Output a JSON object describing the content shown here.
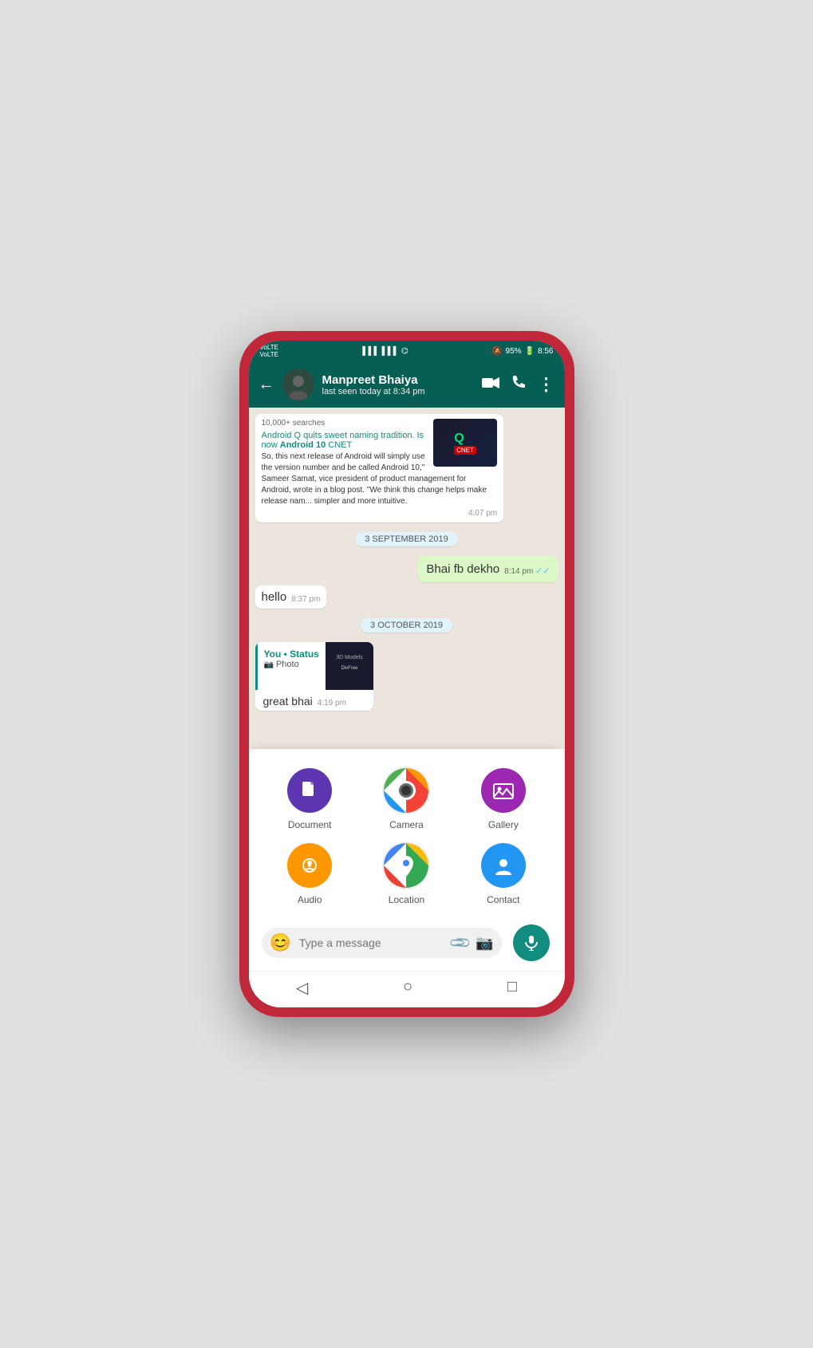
{
  "statusBar": {
    "leftTop": "VoLTE",
    "leftBottom": "VoLTE",
    "signal1": "▌▌▌",
    "signal2": "▌▌▌",
    "wifi": "WiFi",
    "silent": "🔕",
    "battery": "95%",
    "time": "8:56"
  },
  "header": {
    "backLabel": "←",
    "contactName": "Manpreet Bhaiya",
    "lastSeen": "last seen today at 8:34 pm",
    "videoIcon": "📹",
    "callIcon": "📞",
    "moreIcon": "⋮"
  },
  "chat": {
    "articleSearches": "10,000+ searches",
    "articleTitle1": "Android Q quits sweet naming tradition. Is now",
    "articleTitle2": "Android 10",
    "articleSource": "CNET",
    "articleBody": "So, this next release of Android will simply use the version number and be called Android 10,\" Sameer Samat, vice president of product management for Android, wrote in a blog post. \"We think this change helps make release nam... simpler and more intuitive.",
    "articleTime": "4:07 pm",
    "dateSep1": "3 SEPTEMBER 2019",
    "sentMsg": "Bhai fb dekho",
    "sentTime": "8:14 pm",
    "sentTicks": "✓✓",
    "recvMsg": "hello",
    "recvTime": "8:37 pm",
    "dateSep2": "3 OCTOBER 2019",
    "statusFwdLabel": "You • Status",
    "statusFwdSub": "Photo",
    "statusCardBody": "great bhai",
    "statusCardTime": "4:19 pm"
  },
  "attachMenu": {
    "items": [
      {
        "id": "document",
        "label": "Document",
        "iconClass": "icon-doc",
        "icon": "📄"
      },
      {
        "id": "camera",
        "label": "Camera",
        "iconClass": "icon-camera",
        "icon": "📷"
      },
      {
        "id": "gallery",
        "label": "Gallery",
        "iconClass": "icon-gallery",
        "icon": "🖼"
      },
      {
        "id": "audio",
        "label": "Audio",
        "iconClass": "icon-audio",
        "icon": "🎧"
      },
      {
        "id": "location",
        "label": "Location",
        "iconClass": "icon-location",
        "icon": "📍"
      },
      {
        "id": "contact",
        "label": "Contact",
        "iconClass": "icon-contact",
        "icon": "👤"
      }
    ]
  },
  "inputBar": {
    "placeholder": "Type a message",
    "emojiIcon": "😊",
    "attachIcon": "📎",
    "cameraIcon": "📷",
    "micIcon": "🎤"
  },
  "navBar": {
    "back": "◁",
    "home": "○",
    "recent": "□"
  }
}
